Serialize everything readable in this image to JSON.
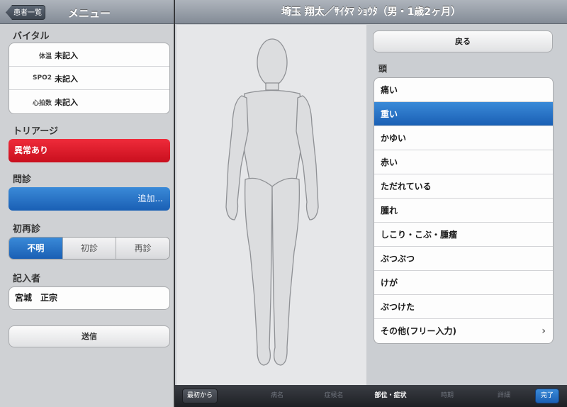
{
  "left": {
    "back_button": "患者一覧",
    "title": "メニュー",
    "vitals": {
      "heading": "バイタル",
      "rows": [
        {
          "label": "体温",
          "value": "未記入"
        },
        {
          "label": "SPO2",
          "value": "未記入"
        },
        {
          "label": "心拍数",
          "value": "未記入"
        }
      ]
    },
    "triage": {
      "heading": "トリアージ",
      "value": "異常あり",
      "color": "#e01828"
    },
    "consult": {
      "heading": "問診",
      "action": "追加..."
    },
    "visit_type": {
      "heading": "初再診",
      "options": [
        "不明",
        "初診",
        "再診"
      ],
      "selected": "不明"
    },
    "author": {
      "heading": "記入者",
      "value": "宮城　正宗"
    },
    "send_button": "送信"
  },
  "right": {
    "patient_title": "埼玉 翔太／ｻｲﾀﾏ ｼｮｳﾀ（男・1歳2ヶ月）",
    "back_button": "戻る",
    "body_part": "頭",
    "symptoms": [
      "痛い",
      "重い",
      "かゆい",
      "赤い",
      "ただれている",
      "腫れ",
      "しこり・こぶ・腫瘤",
      "ぶつぶつ",
      "けが",
      "ぶつけた",
      "その他(フリー入力)"
    ],
    "selected_symptom": "重い",
    "chevron_icon": "chevron-right-icon"
  },
  "bottom": {
    "first_button": "最初から",
    "steps": [
      "病名",
      "症候名",
      "部位・症状",
      "時期",
      "詳細"
    ],
    "current_step": "部位・症状",
    "done_button": "完了"
  },
  "colors": {
    "accent": "#1a5fb4",
    "alert": "#e01828"
  }
}
